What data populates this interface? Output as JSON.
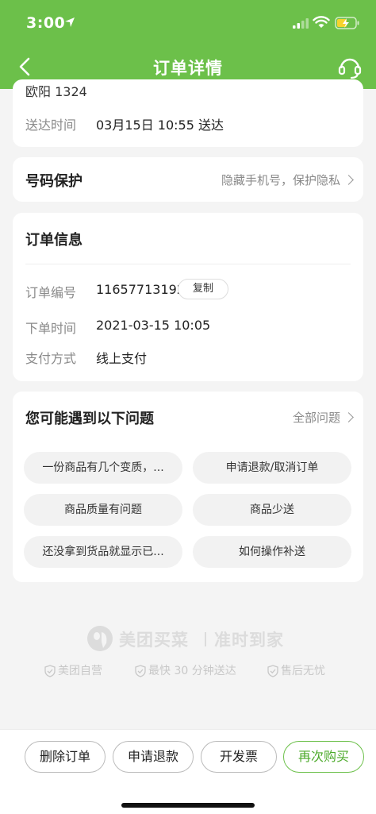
{
  "status_bar": {
    "time": "3:00"
  },
  "nav": {
    "title": "订单详情"
  },
  "delivery_card": {
    "receiver_partial": "欧阳  1324",
    "arrive_label": "送达时间",
    "arrive_value": "03月15日 10:55 送达"
  },
  "number_protect": {
    "title": "号码保护",
    "hint": "隐藏手机号，保护隐私"
  },
  "order_info": {
    "title": "订单信息",
    "rows": [
      {
        "label": "订单编号",
        "value": "11657713192"
      },
      {
        "label": "下单时间",
        "value": "2021-03-15 10:05"
      },
      {
        "label": "支付方式",
        "value": "线上支付"
      }
    ],
    "copy_label": "复制"
  },
  "faq": {
    "title": "您可能遇到以下问题",
    "all_label": "全部问题",
    "items": [
      "一份商品有几个变质，...",
      "申请退款/取消订单",
      "商品质量有问题",
      "商品少送",
      "还没拿到货品就显示已...",
      "如何操作补送"
    ]
  },
  "brand": {
    "name": "美团买菜",
    "slogan": "准时到家",
    "guarantees": [
      "美团自营",
      "最快 30 分钟送达",
      "售后无忧"
    ]
  },
  "bottom_actions": [
    "删除订单",
    "申请退款",
    "开发票",
    "再次购买"
  ],
  "colors": {
    "brand_green": "#6cc04a",
    "page_bg": "#f4f4f4"
  }
}
